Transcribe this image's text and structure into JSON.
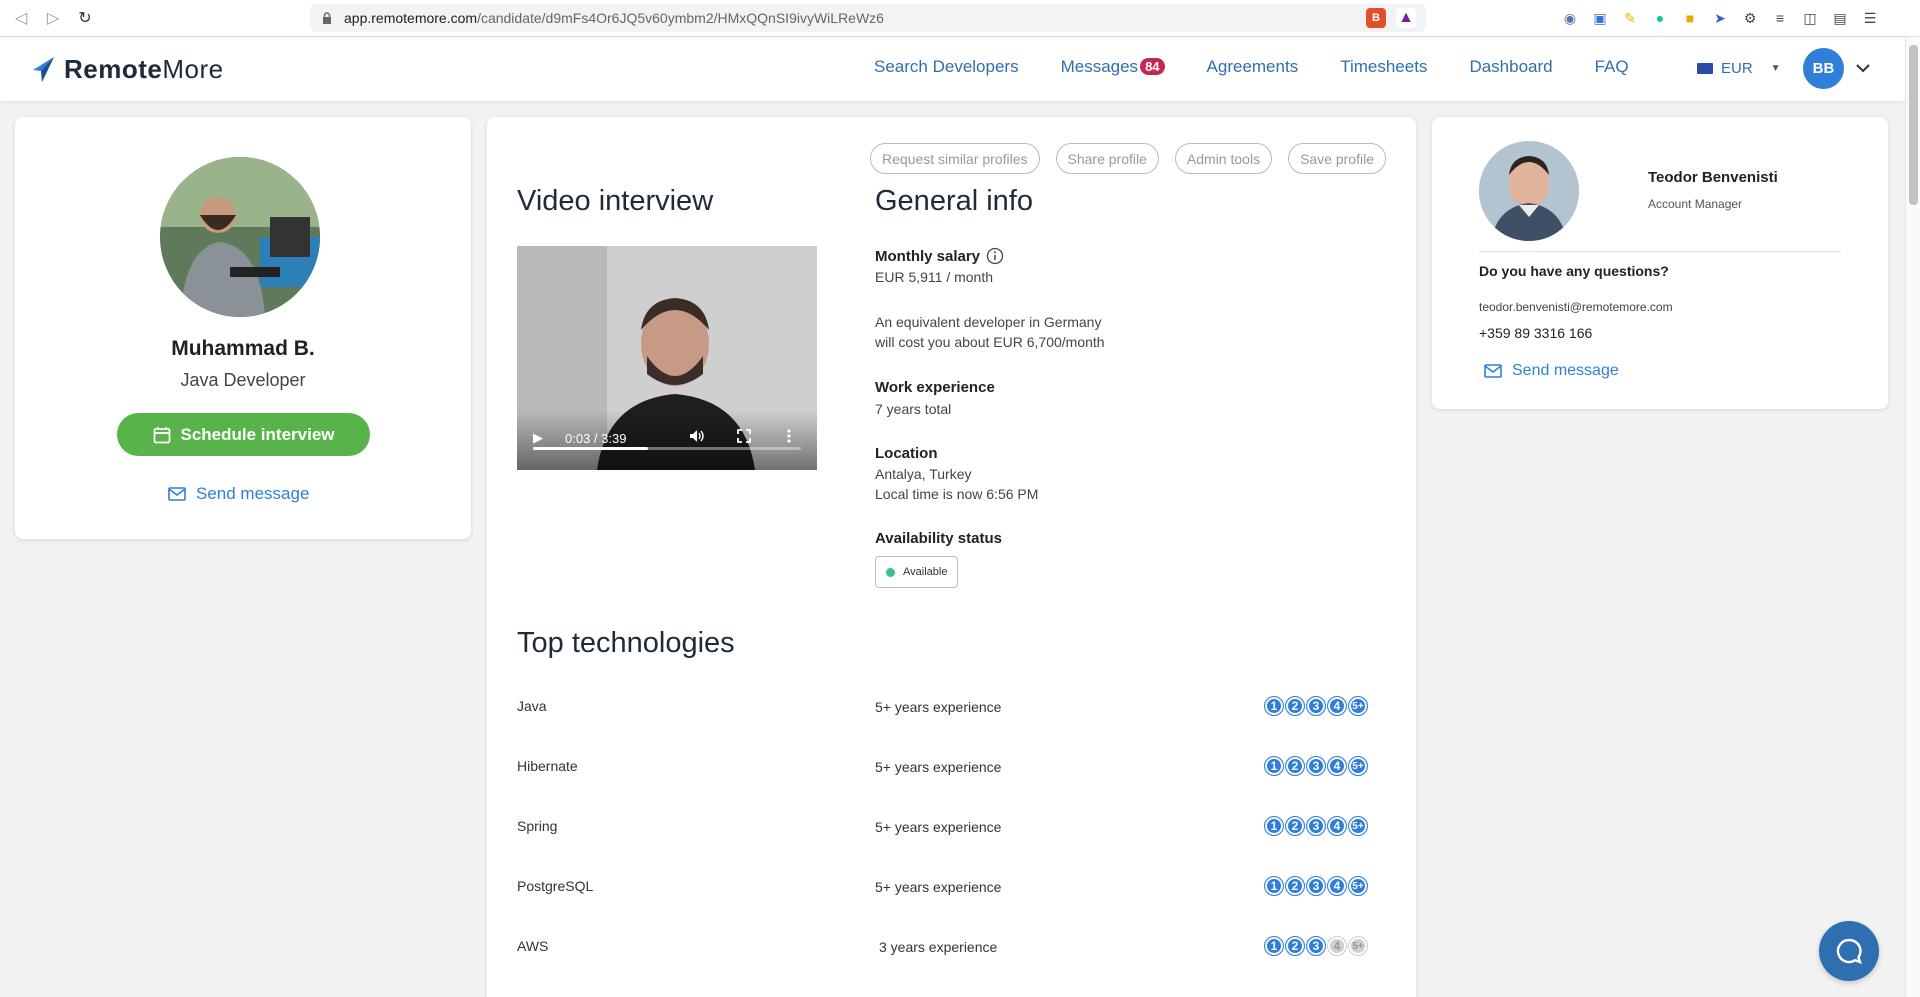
{
  "browser": {
    "url_host": "app.remotemore.com",
    "url_path": "/candidate/d9mFs4Or6JQ5v60ymbm2/HMxQQnSI9ivyWiLReWz6"
  },
  "header": {
    "logo_bold": "Remote",
    "logo_light": "More",
    "nav": {
      "search": "Search Developers",
      "messages": "Messages",
      "messages_count": "84",
      "agreements": "Agreements",
      "timesheets": "Timesheets",
      "dashboard": "Dashboard",
      "faq": "FAQ"
    },
    "currency": "EUR",
    "avatar_initials": "BB"
  },
  "candidate": {
    "name": "Muhammad B.",
    "role": "Java Developer",
    "schedule_label": "Schedule interview",
    "send_label": "Send message"
  },
  "toolbar": {
    "request_similar": "Request similar profiles",
    "share": "Share profile",
    "admin": "Admin tools",
    "save": "Save profile"
  },
  "video": {
    "title": "Video interview",
    "time": "0:03 / 3:39",
    "progress_fraction": 0.43
  },
  "general": {
    "title": "General info",
    "salary_label": "Monthly salary",
    "salary_value": "EUR 5,911 / month",
    "equivalent_line1": "An equivalent developer in Germany",
    "equivalent_line2": "will cost you about EUR 6,700/month",
    "experience_label": "Work experience",
    "experience_value": "7 years total",
    "location_label": "Location",
    "location_city": "Antalya, Turkey",
    "location_time": "Local time is now 6:56 PM",
    "availability_label": "Availability status",
    "availability_value": "Available"
  },
  "technologies": {
    "title": "Top technologies",
    "levels": [
      "1",
      "2",
      "3",
      "4",
      "5+"
    ],
    "items": [
      {
        "name": "Java",
        "experience": "5+ years experience",
        "level": 5
      },
      {
        "name": "Hibernate",
        "experience": "5+ years experience",
        "level": 5
      },
      {
        "name": "Spring",
        "experience": "5+ years experience",
        "level": 5
      },
      {
        "name": "PostgreSQL",
        "experience": "5+ years experience",
        "level": 5
      },
      {
        "name": "AWS",
        "experience": "3 years experience",
        "level": 3
      }
    ]
  },
  "account_manager": {
    "name": "Teodor Benvenisti",
    "role": "Account Manager",
    "question": "Do you have any questions?",
    "email": "teodor.benvenisti@remotemore.com",
    "phone": "+359 89 3316 166",
    "send_label": "Send message"
  },
  "colors": {
    "accent": "#2f7fd9",
    "schedule_green": "#59b34b",
    "badge_red": "#c7264e",
    "available_green": "#3fbf8a"
  }
}
